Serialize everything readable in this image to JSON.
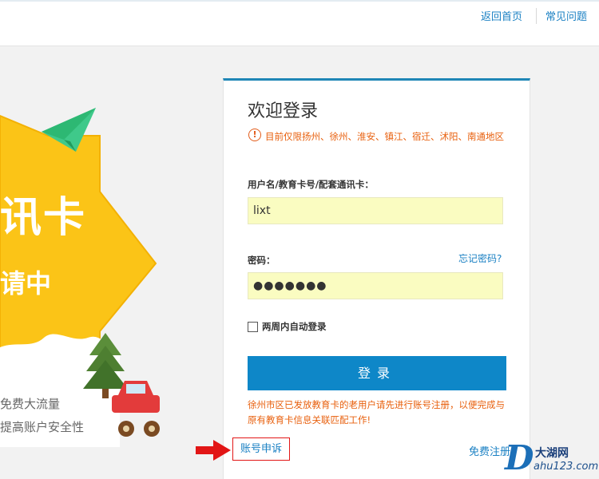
{
  "nav": {
    "home_label": "返回首页",
    "faq_label": "常见问题"
  },
  "promo": {
    "headline": "讯卡",
    "subline": "请中",
    "line1": "免费大流量",
    "line2": "提高账户安全性"
  },
  "login": {
    "title": "欢迎登录",
    "notice": "目前仅限扬州、徐州、淮安、镇江、宿迁、沭阳、南通地区",
    "username_label": "用户名/教育卡号/配套通讯卡：",
    "username_value": "lixt",
    "password_label": "密码：",
    "forgot_label": "忘记密码?",
    "password_masked": "●●●●●●●",
    "remember_label": "两周内自动登录",
    "remember_checked": false,
    "submit_label": "登录",
    "register_notice": "徐州市区已发放教育卡的老用户请先进行账号注册，以便完成与原有教育卡信息关联匹配工作!",
    "appeal_label": "账号申诉",
    "register_label": "免费注册"
  },
  "watermark": {
    "letter": "D",
    "name": "大湖网",
    "url": "ahu123.com"
  },
  "colors": {
    "accent": "#0e87c8",
    "warning": "#e8600e",
    "link": "#1a80c3",
    "promo_yellow": "#fbc417"
  }
}
